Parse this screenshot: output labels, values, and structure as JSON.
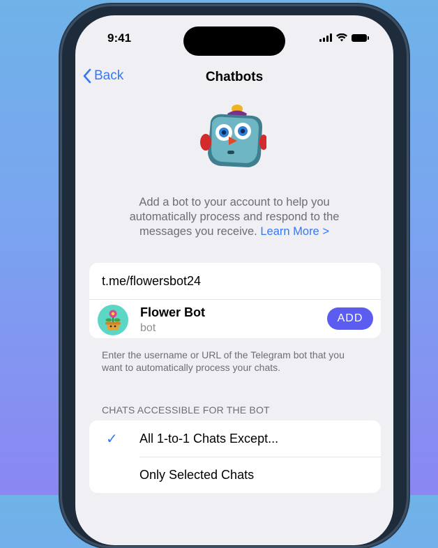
{
  "status_bar": {
    "time": "9:41"
  },
  "nav": {
    "back_label": "Back",
    "title": "Chatbots"
  },
  "description": {
    "text": "Add a bot to your account to help you automatically process and respond to the messages you receive.",
    "link": "Learn More >"
  },
  "bot_card": {
    "url_value": "t.me/flowersbot24",
    "result": {
      "name": "Flower Bot",
      "subtitle": "bot",
      "add_label": "ADD"
    }
  },
  "hint_text": "Enter the username or URL of the Telegram bot that you want to automatically process your chats.",
  "access_section": {
    "header": "CHATS ACCESSIBLE FOR THE BOT",
    "options": [
      {
        "label": "All 1-to-1 Chats Except...",
        "selected": true
      },
      {
        "label": "Only Selected Chats",
        "selected": false
      }
    ]
  },
  "colors": {
    "accent": "#3478f6",
    "add_button": "#5b5cf0",
    "background": "#efeff4"
  }
}
